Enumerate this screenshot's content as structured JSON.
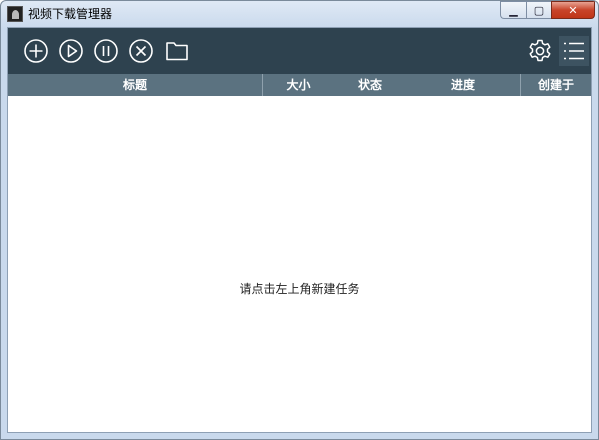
{
  "window": {
    "title": "视频下载管理器"
  },
  "window_controls": {
    "minimize": "▁",
    "maximize": "▢",
    "close": "✕"
  },
  "toolbar": {
    "left_buttons": [
      "add-task",
      "start",
      "pause",
      "delete",
      "open-folder"
    ],
    "right_buttons": [
      "settings",
      "menu"
    ]
  },
  "table": {
    "columns": [
      "标题",
      "大小",
      "状态",
      "进度",
      "创建于"
    ]
  },
  "empty_message": "请点击左上角新建任务",
  "colors": {
    "toolbar_bg": "#2e424f",
    "header_bg": "#5b7280",
    "icon": "#ffffff"
  }
}
